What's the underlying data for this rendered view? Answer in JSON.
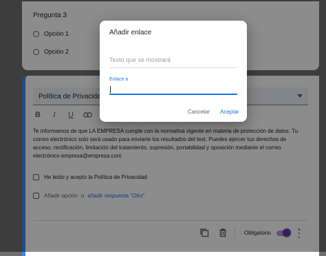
{
  "question_prev": {
    "title": "Pregunta 3",
    "options": [
      "Opción 1",
      "Opción 2"
    ]
  },
  "question_current": {
    "title": "Política de Privacidad",
    "description": "Te informamos de que LA EMPRESA cumple con la normativa vigente en materia de protección de datos. Tu correo electrónico solo será usado para enviarte los resultados del test. Puedes ejercer tus derechos de acceso, rectificación, limitación del tratamiento, supresión, portabilidad y oposición mediante el correo electrónico empresa@empresa.com",
    "checkbox_option": "He leído y acepto la Política de Privacidad",
    "add_option": "Añadir opción",
    "or_label": "o",
    "add_other": "añadir respuesta \"Otro\"",
    "required_label": "Obligatorio",
    "required": true
  },
  "format_bar": [
    "B",
    "I",
    "U",
    "link",
    "clear-format"
  ],
  "dialog": {
    "title": "Añadir enlace",
    "text_placeholder": "Texto que se mostrará",
    "link_label": "Enlace a",
    "link_value": "",
    "cancel": "Cancelar",
    "accept": "Aceptar"
  },
  "colors": {
    "accent": "#1a73e8",
    "toggle": "#673ab7",
    "active_border": "#4285f4"
  }
}
